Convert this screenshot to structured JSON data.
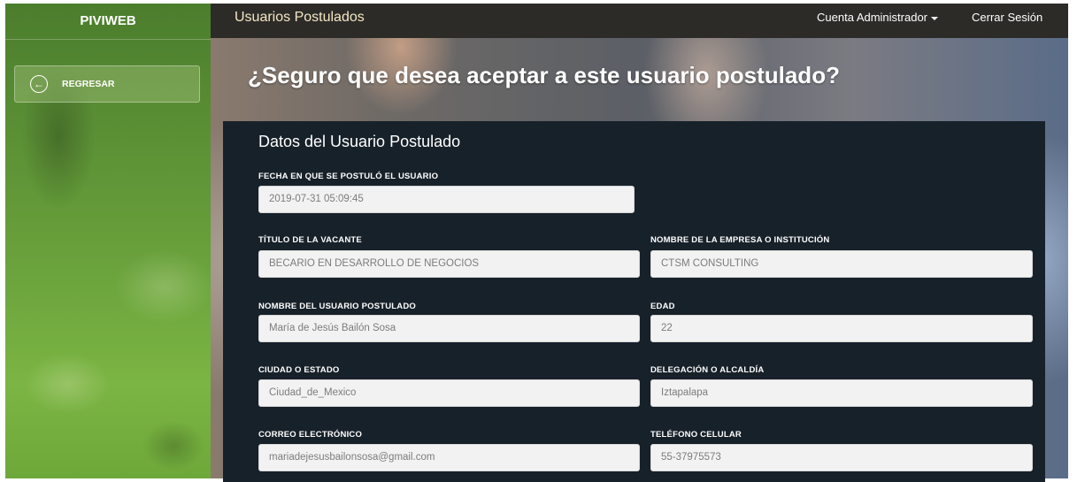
{
  "sidebar": {
    "brand": "PIVIWEB",
    "back_button": {
      "icon": "arrow-left-circle-icon",
      "label": "REGRESAR"
    }
  },
  "topbar": {
    "title": "Usuarios Postulados",
    "account_menu": "Cuenta Administrador",
    "logout": "Cerrar Sesión"
  },
  "hero": {
    "heading": "¿Seguro que desea aceptar a este usuario postulado?"
  },
  "card": {
    "title": "Datos del Usuario Postulado",
    "fields": {
      "fecha": {
        "label": "FECHA EN QUE SE POSTULÓ EL USUARIO",
        "value": "2019-07-31 05:09:45"
      },
      "titulo_vacante": {
        "label": "TÍTULO DE LA VACANTE",
        "value": "BECARIO EN DESARROLLO DE NEGOCIOS"
      },
      "empresa": {
        "label": "NOMBRE DE LA EMPRESA O INSTITUCIÓN",
        "value": "CTSM CONSULTING"
      },
      "nombre": {
        "label": "NOMBRE DEL USUARIO POSTULADO",
        "value": "María de Jesús Bailón Sosa"
      },
      "edad": {
        "label": "EDAD",
        "value": "22"
      },
      "ciudad": {
        "label": "CIUDAD O ESTADO",
        "value": "Ciudad_de_Mexico"
      },
      "delegacion": {
        "label": "DELEGACIÓN O ALCALDÍA",
        "value": "Iztapalapa"
      },
      "correo": {
        "label": "CORREO ELECTRÓNICO",
        "value": "mariadejesusbailonsosa@gmail.com"
      },
      "telefono": {
        "label": "TELÉFONO CELULAR",
        "value": "55-37975573"
      }
    }
  }
}
